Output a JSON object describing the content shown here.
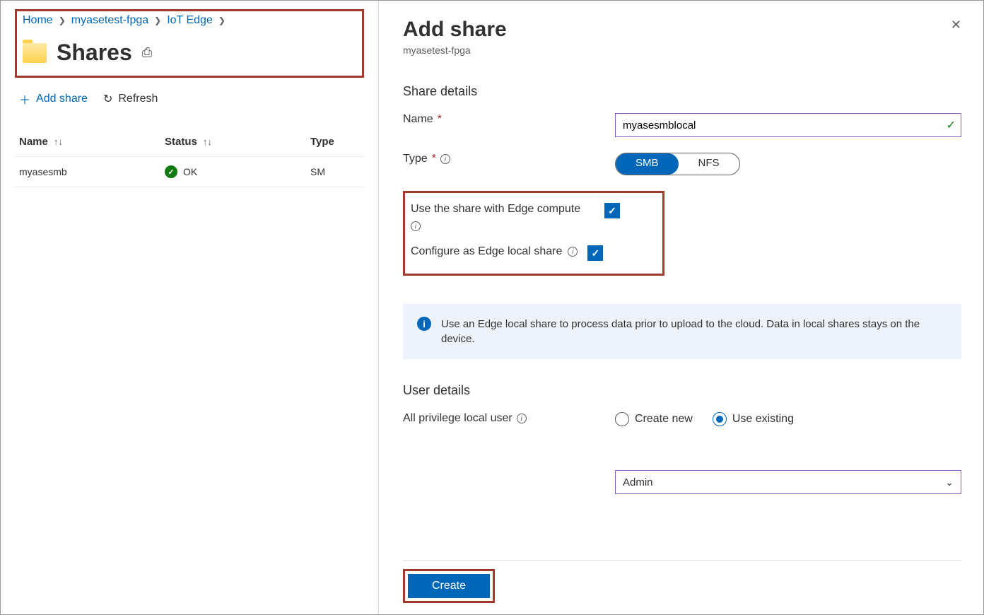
{
  "breadcrumb": {
    "home": "Home",
    "resource": "myasetest-fpga",
    "service": "IoT Edge"
  },
  "page": {
    "title": "Shares"
  },
  "toolbar": {
    "add": "Add share",
    "refresh": "Refresh"
  },
  "table": {
    "headers": {
      "name": "Name",
      "status": "Status",
      "type": "Type"
    },
    "rows": [
      {
        "name": "myasesmb",
        "status": "OK",
        "type": "SMB"
      }
    ]
  },
  "panel": {
    "title": "Add share",
    "subtitle": "myasetest-fpga",
    "section1": "Share details",
    "name_label": "Name",
    "name_value": "myasesmblocal",
    "type_label": "Type",
    "type_options": {
      "smb": "SMB",
      "nfs": "NFS"
    },
    "edge_compute_label": "Use the share with Edge compute",
    "edge_local_label": "Configure as Edge local share",
    "info_text": "Use an Edge local share to process data prior to upload to the cloud. Data in local shares stays on the device.",
    "section2": "User details",
    "user_label": "All privilege local user",
    "radio_create": "Create new",
    "radio_existing": "Use existing",
    "user_value": "Admin",
    "create_btn": "Create"
  }
}
